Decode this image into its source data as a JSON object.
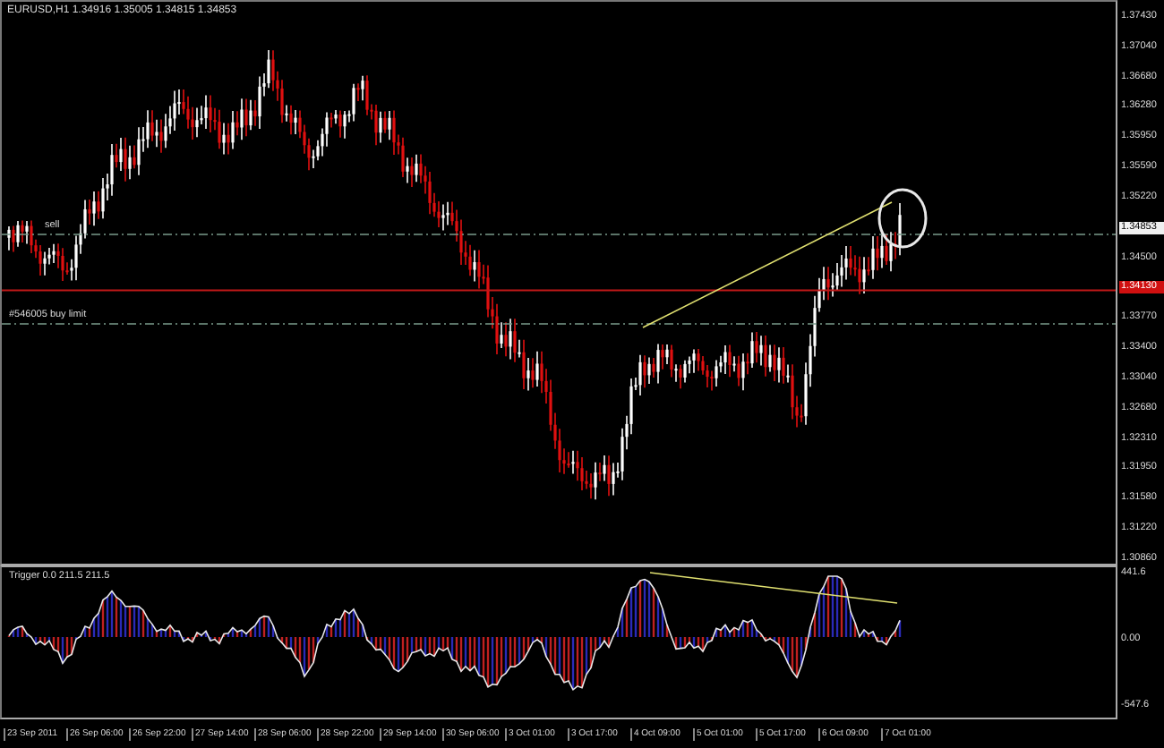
{
  "chart": {
    "title": "EURUSD,H1  1.34916 1.35005 1.34815 1.34853",
    "order_lines": [
      {
        "label": "sell",
        "kind": "sell"
      },
      {
        "label": "#546005 buy limit",
        "kind": "buy_limit"
      }
    ]
  },
  "price_axis": [
    {
      "text": "1.37430",
      "kind": "plain"
    },
    {
      "text": "1.37040",
      "kind": "plain"
    },
    {
      "text": "1.36680",
      "kind": "plain"
    },
    {
      "text": "1.36280",
      "kind": "plain"
    },
    {
      "text": "1.35950",
      "kind": "plain"
    },
    {
      "text": "1.35590",
      "kind": "plain"
    },
    {
      "text": "1.35220",
      "kind": "plain"
    },
    {
      "text": "1.34853",
      "kind": "bid"
    },
    {
      "text": "1.34500",
      "kind": "plain"
    },
    {
      "text": "1.34130",
      "kind": "alert"
    },
    {
      "text": "1.33770",
      "kind": "plain"
    },
    {
      "text": "1.33400",
      "kind": "plain"
    },
    {
      "text": "1.33040",
      "kind": "plain"
    },
    {
      "text": "1.32680",
      "kind": "plain"
    },
    {
      "text": "1.32310",
      "kind": "plain"
    },
    {
      "text": "1.31950",
      "kind": "plain"
    },
    {
      "text": "1.31580",
      "kind": "plain"
    },
    {
      "text": "1.31220",
      "kind": "plain"
    },
    {
      "text": "1.30860",
      "kind": "plain"
    }
  ],
  "indicator": {
    "label": "Trigger 0.0 211.5 211.5",
    "axis": [
      "441.6",
      "0.00",
      "-547.6"
    ]
  },
  "time_axis": [
    "23 Sep 2011",
    "26 Sep 06:00",
    "26 Sep 22:00",
    "27 Sep 14:00",
    "28 Sep 06:00",
    "28 Sep 22:00",
    "29 Sep 14:00",
    "30 Sep 06:00",
    "3 Oct 01:00",
    "3 Oct 17:00",
    "4 Oct 09:00",
    "5 Oct 01:00",
    "5 Oct 17:00",
    "6 Oct 09:00",
    "7 Oct 01:00"
  ]
}
